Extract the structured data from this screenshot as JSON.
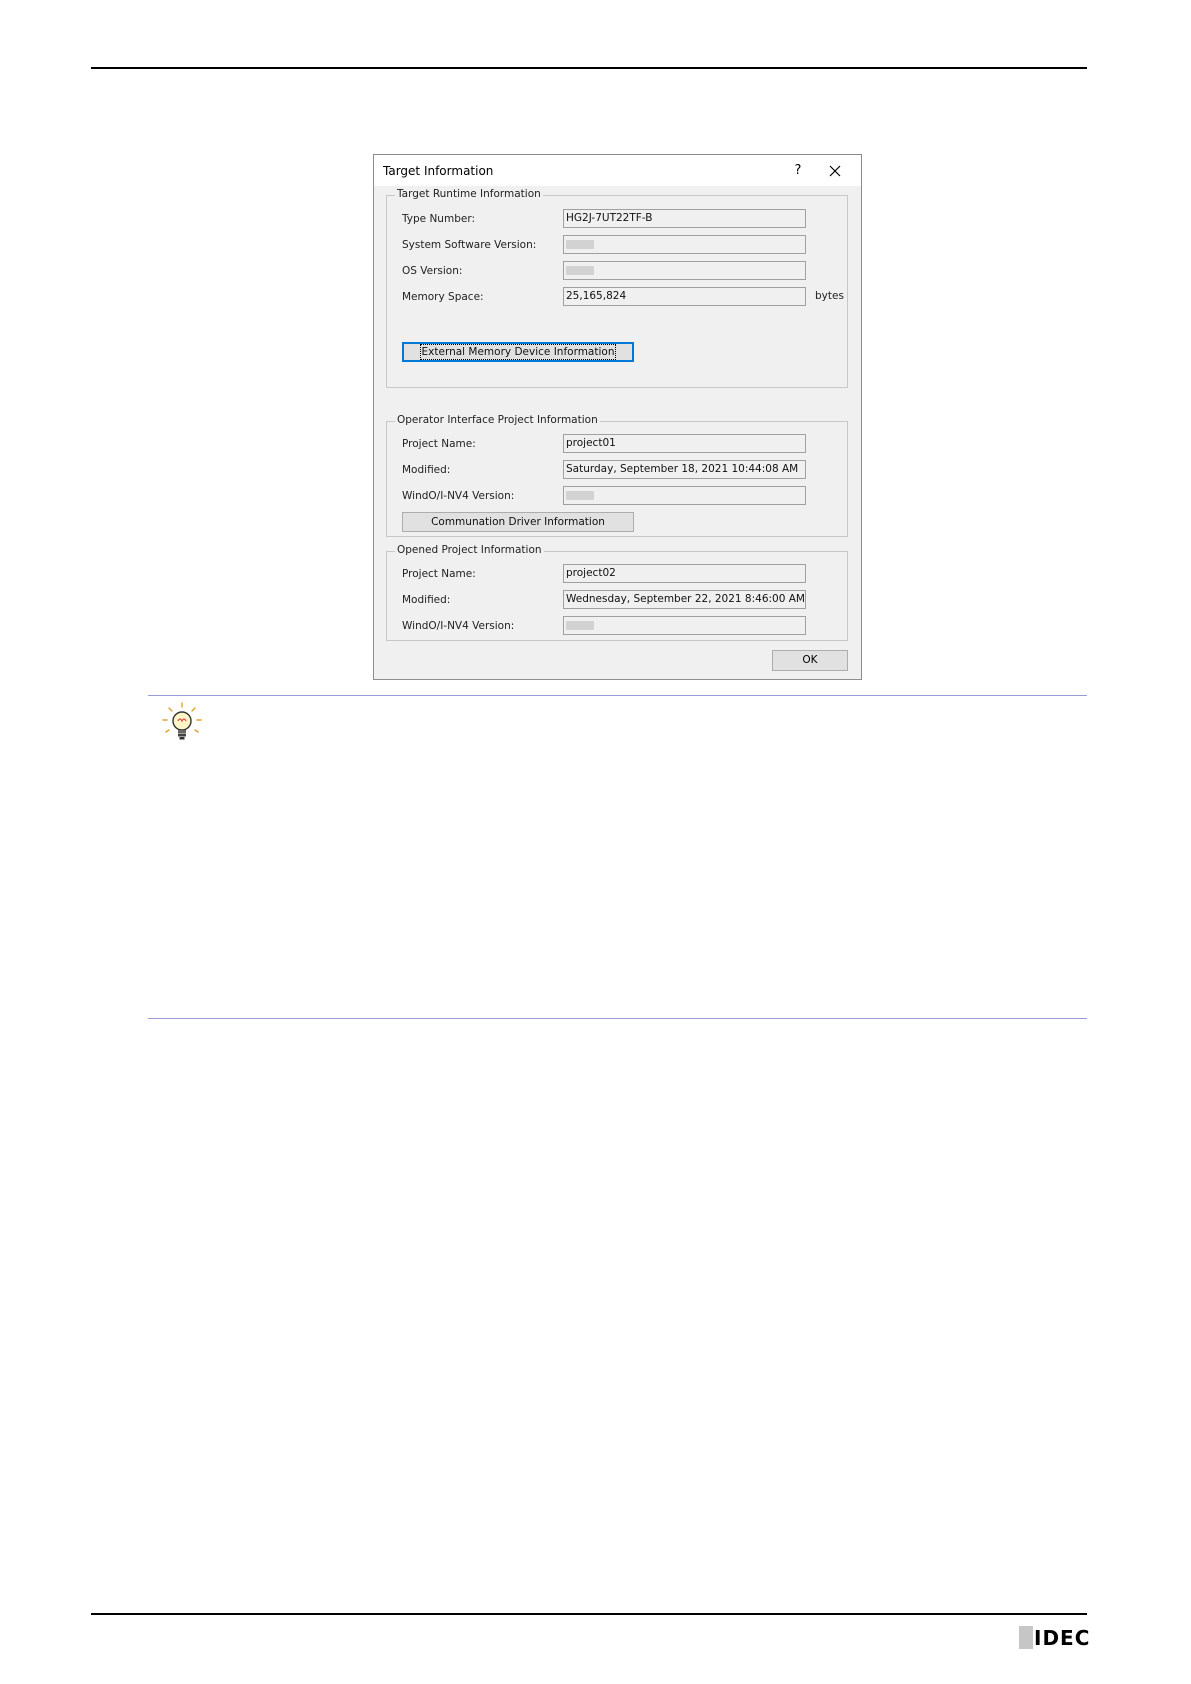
{
  "dialog": {
    "title": "Target Information",
    "help_label": "?",
    "runtime": {
      "group_title": "Target Runtime Information",
      "type_number_label": "Type Number:",
      "type_number_value": "HG2J-7UT22TF-B",
      "system_software_label": "System Software Version:",
      "os_version_label": "OS Version:",
      "memory_space_label": "Memory Space:",
      "memory_space_value": "25,165,824",
      "memory_space_unit": "bytes",
      "external_memory_button": "External Memory Device Information"
    },
    "operator_project": {
      "group_title": "Operator Interface Project Information",
      "project_name_label": "Project Name:",
      "project_name_value": "project01",
      "modified_label": "Modified:",
      "modified_value": "Saturday, September 18, 2021 10:44:08 AM",
      "windo_version_label": "WindO/I-NV4 Version:",
      "comm_driver_button": "Communation Driver Information"
    },
    "opened_project": {
      "group_title": "Opened Project Information",
      "project_name_label": "Project Name:",
      "project_name_value": "project02",
      "modified_label": "Modified:",
      "modified_value": "Wednesday, September 22, 2021 8:46:00 AM",
      "windo_version_label": "WindO/I-NV4 Version:"
    },
    "ok_label": "OK"
  },
  "footer": {
    "logo_text": "IDEC"
  },
  "colors": {
    "focus_border": "#0078d7",
    "hint_rule": "#9a9ad6"
  }
}
